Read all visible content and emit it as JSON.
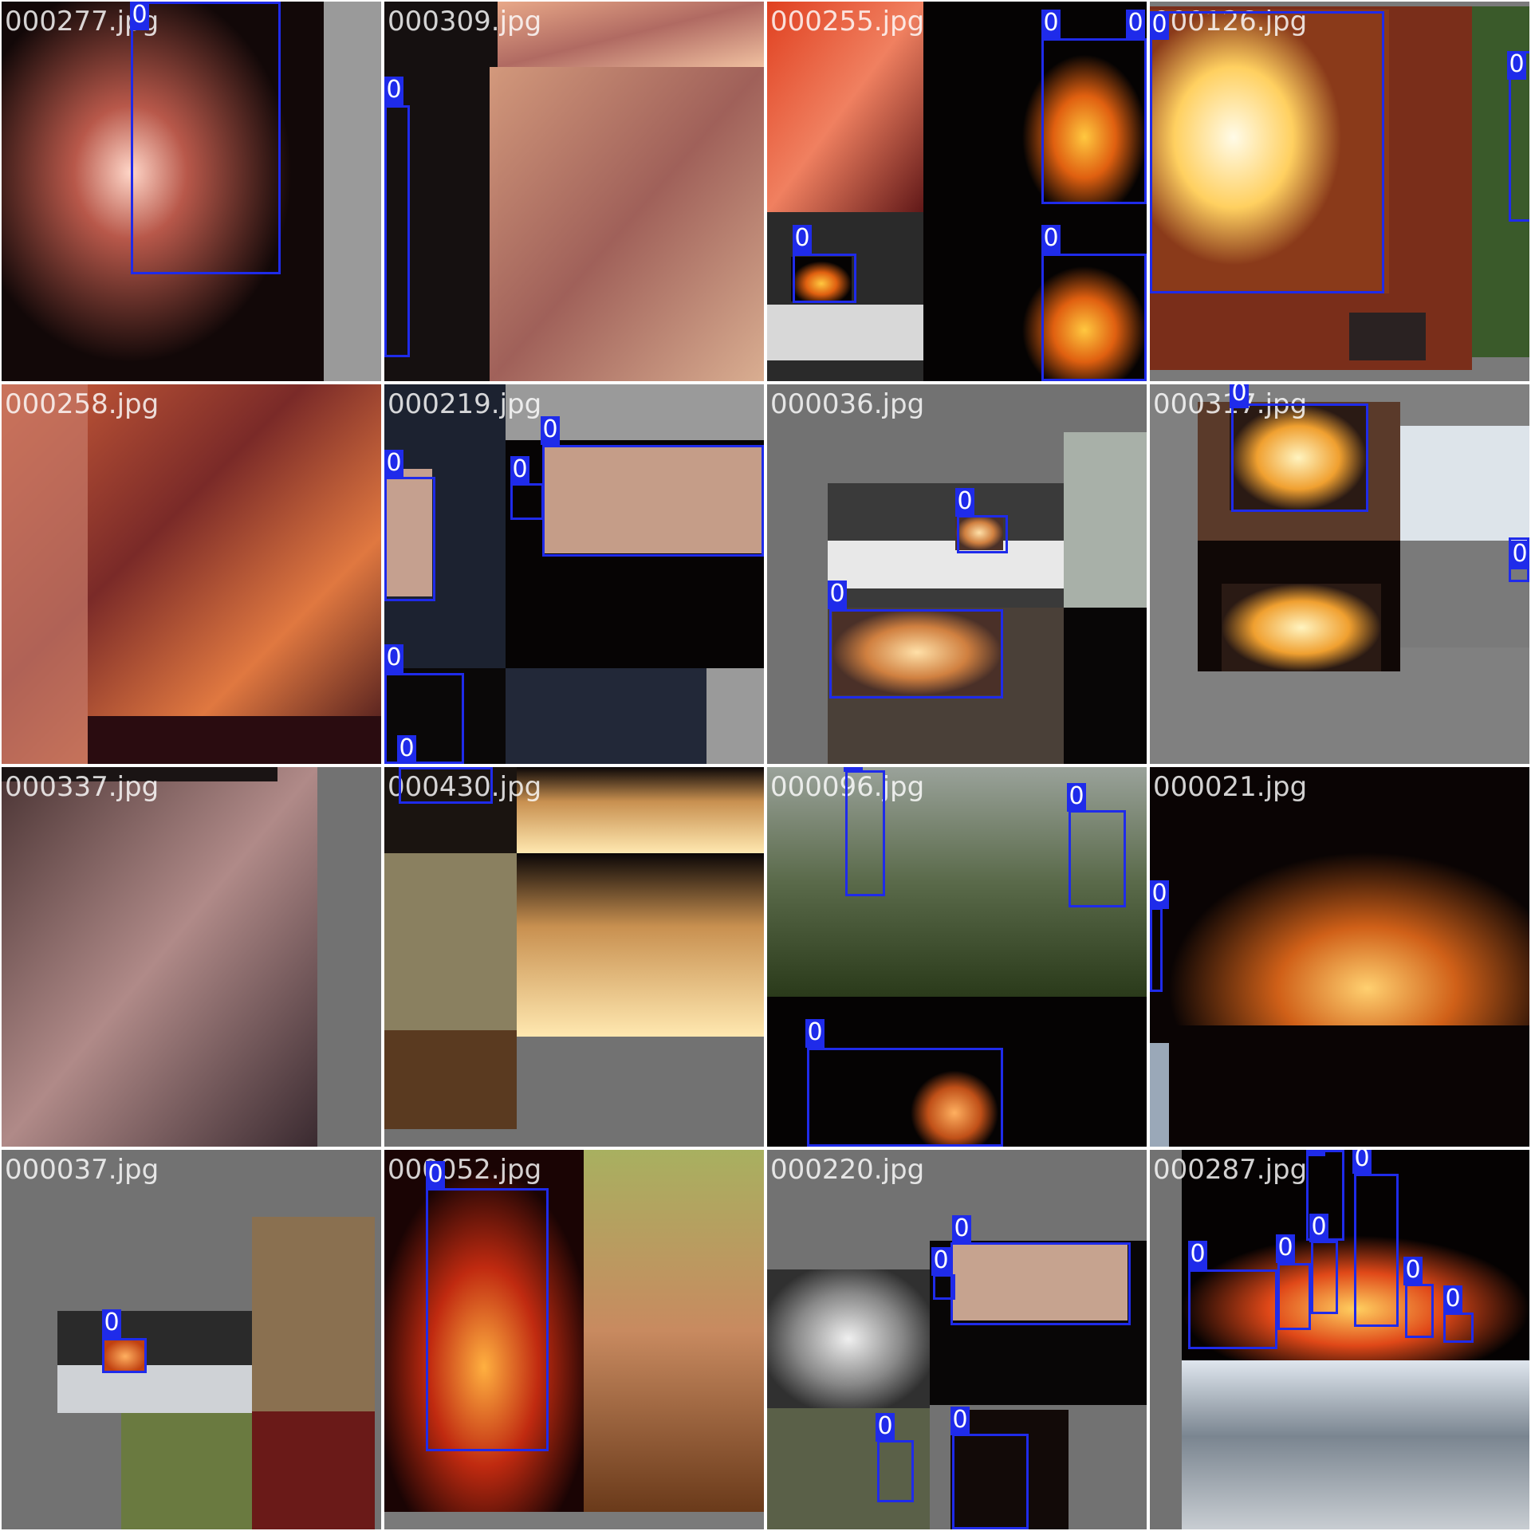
{
  "mosaic": {
    "tiles": [
      {
        "filename": "000277.jpg",
        "box_labels": [
          "0"
        ]
      },
      {
        "filename": "000309.jpg",
        "box_labels": [
          "0"
        ]
      },
      {
        "filename": "000255.jpg",
        "box_labels": [
          "0",
          "0",
          "0",
          "0"
        ]
      },
      {
        "filename": "000126.jpg",
        "box_labels": [
          "0",
          "0"
        ]
      },
      {
        "filename": "000258.jpg",
        "box_labels": []
      },
      {
        "filename": "000219.jpg",
        "box_labels": [
          "0",
          "0",
          "0",
          "0",
          "0"
        ]
      },
      {
        "filename": "000036.jpg",
        "box_labels": [
          "0",
          "0"
        ]
      },
      {
        "filename": "000317.jpg",
        "box_labels": [
          "0",
          "0"
        ]
      },
      {
        "filename": "000337.jpg",
        "box_labels": []
      },
      {
        "filename": "000430.jpg",
        "box_labels": []
      },
      {
        "filename": "000096.jpg",
        "box_labels": [
          "0",
          "0",
          "0"
        ]
      },
      {
        "filename": "000021.jpg",
        "box_labels": [
          "0"
        ]
      },
      {
        "filename": "000037.jpg",
        "box_labels": [
          "0"
        ]
      },
      {
        "filename": "000052.jpg",
        "box_labels": [
          "0"
        ]
      },
      {
        "filename": "000220.jpg",
        "box_labels": [
          "0",
          "0",
          "0",
          "0"
        ]
      },
      {
        "filename": "000287.jpg",
        "box_labels": [
          "0",
          "0",
          "0",
          "0",
          "0",
          "0",
          "0"
        ]
      }
    ]
  },
  "colors": {
    "box_border": "#1f2bea",
    "label_text": "#ffffff",
    "padding_gray": "#727272"
  }
}
